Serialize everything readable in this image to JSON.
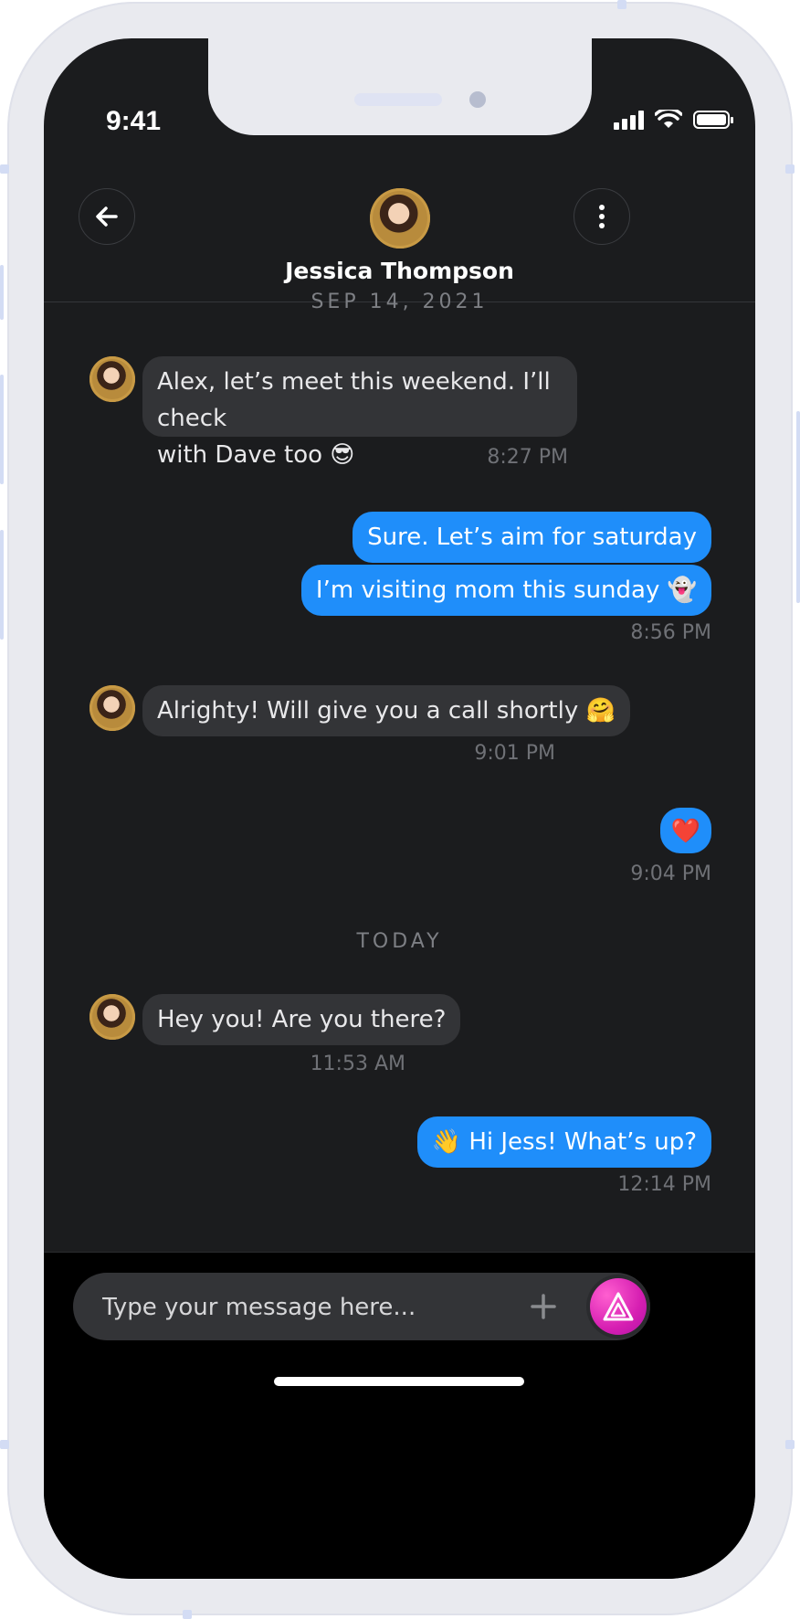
{
  "status_bar": {
    "time": "9:41"
  },
  "header": {
    "contact_name": "Jessica Thompson"
  },
  "date_separators": [
    "SEP 14, 2021",
    "TODAY"
  ],
  "messages": [
    {
      "direction": "in",
      "text": "Alex, let’s meet this weekend. I’ll check\nwith Dave too 😎",
      "time": "8:27 PM"
    },
    {
      "direction": "out",
      "text": "Sure. Let’s aim for saturday",
      "time": ""
    },
    {
      "direction": "out",
      "text": "I’m visiting mom this sunday 👻",
      "time": "8:56 PM"
    },
    {
      "direction": "in",
      "text": "Alrighty! Will give you a call shortly 🤗",
      "time": "9:01 PM"
    },
    {
      "direction": "out",
      "text": "❤️",
      "time": "9:04 PM"
    },
    {
      "direction": "in",
      "text": "Hey you! Are you there?",
      "time": "11:53 AM"
    },
    {
      "direction": "out",
      "text": "👋 Hi Jess! What’s up?",
      "time": "12:14 PM"
    }
  ],
  "composer": {
    "placeholder": "Type your message here..."
  },
  "icons": {
    "back": "arrow-left-icon",
    "menu": "more-vertical-icon",
    "add": "plus-icon",
    "send": "send-triangle-icon"
  },
  "colors": {
    "background": "#1b1c1e",
    "incoming_bubble": "#333437",
    "outgoing_bubble": "#1f8efa",
    "send_button": "#d61fb2"
  }
}
